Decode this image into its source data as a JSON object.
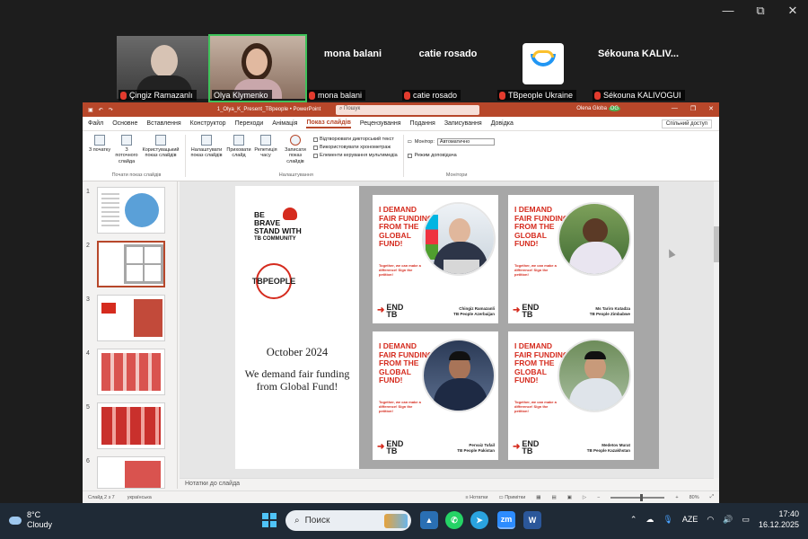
{
  "window_controls": {
    "minimize": "—",
    "maximize": "⧉",
    "close": "✕"
  },
  "participants": [
    {
      "label": "Çingiz Ramazanlı"
    },
    {
      "label": "Olya Klymenko"
    },
    {
      "name": "mona balani",
      "label": "mona balani"
    },
    {
      "name": "catie rosado",
      "label": "catie rosado"
    },
    {
      "label": "TBpeople Ukraine"
    },
    {
      "name": "Sékouna  KALIV...",
      "label": "Sékouna KALIVOGUI"
    }
  ],
  "ppt": {
    "filename": "1_Olya_K_Present_TBpeople  •  PowerPoint",
    "search_placeholder": "Пошук",
    "user": "Olena Globa",
    "user_initials": "OG",
    "tabs": [
      "Файл",
      "Основне",
      "Вставлення",
      "Конструктор",
      "Переходи",
      "Анімація",
      "Показ слайдів",
      "Рецензування",
      "Подання",
      "Записування",
      "Довідка"
    ],
    "active_tab": "Показ слайдів",
    "share_label": "Спільний доступ",
    "ribbon": {
      "group1": {
        "buttons": [
          "З початку",
          "З поточного слайда",
          "Користувацький показ слайдів"
        ],
        "label": "Почати показ слайдів"
      },
      "group2": {
        "buttons": [
          "Налаштувати показ слайдів",
          "Приховати слайд",
          "Репетиція часу",
          "Записати показ слайдів"
        ],
        "checks": [
          "Відтворювати дикторський текст",
          "Використовувати хронометраж",
          "Елементи керування мультимедіа"
        ],
        "label": "Налаштування"
      },
      "group3": {
        "monitor_label": "Монітор:",
        "monitor_value": "Автоматично",
        "presenter_view": "Режим доповідача",
        "label": "Монітори"
      }
    },
    "thumb_numbers": [
      "1",
      "2",
      "3",
      "4",
      "5",
      "6"
    ],
    "notes_placeholder": "Нотатки до слайда",
    "status": {
      "slide": "Слайд 2 з 7",
      "language": "українська",
      "notes_btn": "Нотатки",
      "display_btn": "Примітки",
      "zoom": "80%"
    }
  },
  "slide": {
    "brave_line1": "BE",
    "brave_line2": "BRAVE",
    "brave_line3": "STAND WITH",
    "brave_line4": "TB COMMUNITY",
    "logo_text": "TBPEOPLE",
    "date": "October 2024",
    "message": "We demand fair funding from Global Fund!",
    "cards": [
      {
        "title": "I DEMAND FAIR FUNDING FROM THE GLOBAL FUND!",
        "tagline": "Together, we can make a difference! Sign the petition!",
        "end": "END",
        "tb": "TB",
        "name": "Chingiz Ramazanli",
        "org": "TB People Azerbaijan"
      },
      {
        "title": "I DEMAND FAIR FUNDING FROM THE GLOBAL FUND!",
        "tagline": "Together, we can make a difference! Sign the petition!",
        "end": "END",
        "tb": "TB",
        "name": "Ms Tariro Kutadza",
        "org": "TB People Zimbabwe"
      },
      {
        "title": "I DEMAND FAIR FUNDING FROM THE GLOBAL FUND!",
        "tagline": "Together, we can make a difference! Sign the petition!",
        "end": "END",
        "tb": "TB",
        "name": "Pervaiz Tufail",
        "org": "TB People Pakistan"
      },
      {
        "title": "I DEMAND FAIR FUNDING FROM THE GLOBAL FUND!",
        "tagline": "Together, we can make a difference! Sign the petition!",
        "end": "END",
        "tb": "TB",
        "name": "Medetov Murat",
        "org": "TB People Kazakhstan"
      }
    ]
  },
  "taskbar": {
    "weather_temp": "8°C",
    "weather_desc": "Cloudy",
    "search_label": "Поиск",
    "lang": "AZE",
    "time": "17:40",
    "date": "16.12.2025",
    "zoom_app": "zm",
    "word_app": "W"
  },
  "colors": {
    "ppt_red": "#b7472a",
    "tb_red": "#d52b1e",
    "active_speaker": "#3fc25a"
  }
}
